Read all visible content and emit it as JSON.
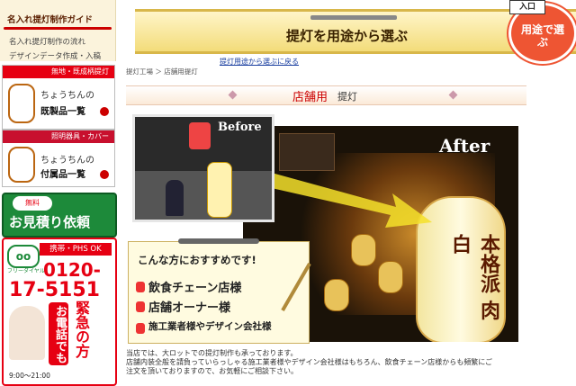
{
  "sidebar": {
    "guide": {
      "title": "名入れ提灯制作ガイド",
      "items": [
        "名入れ提灯制作の流れ",
        "デザインデータ作成・入稿"
      ]
    },
    "banner1": {
      "tag": "無地・既成柄提灯",
      "line1": "ちょうちんの",
      "line2": "既製品一覧"
    },
    "banner2": {
      "tag": "照明器具・カバー",
      "line1": "ちょうちんの",
      "line2": "付属品一覧"
    },
    "quote": {
      "tag": "無料",
      "text": "お見積り依頼"
    },
    "phone": {
      "tag": "携帯・PHS OK",
      "freedial_label": "フリーダイヤル",
      "number_part1": "0120-",
      "number_part2": "17-5151",
      "urgent": "緊急の方",
      "call": "お電話でも",
      "hours": "9:00〜21:00"
    }
  },
  "header": {
    "banner_title": "提灯を用途から選ぶ",
    "entrance_label": "入口",
    "youto_badge": "用途で選ぶ"
  },
  "link_partial": "提灯用途から選ぶに戻る",
  "breadcrumb": "提灯工場 ＞ 店舗用提灯",
  "section": {
    "title_red": "店舗用",
    "title_rest": "提灯"
  },
  "photos": {
    "before_label": "Before",
    "after_label": "After",
    "lantern_text": "本格派 肉 白"
  },
  "recommend": {
    "title": "こんな方におすすめです!",
    "items": [
      "飲食チェーン店様",
      "店舗オーナー様",
      "施工業者様やデザイン会社様"
    ]
  },
  "body": {
    "line1": "当店では、大ロットでの提灯制作も承っております。",
    "line2": "店舗内装全般を請負っていらっしゃる施工業者様やデザイン会社様はもちろん、飲食チェーン店様からも頻繁にご",
    "line3": "注文を頂いておりますので、お気軽にご相談下さい。"
  }
}
